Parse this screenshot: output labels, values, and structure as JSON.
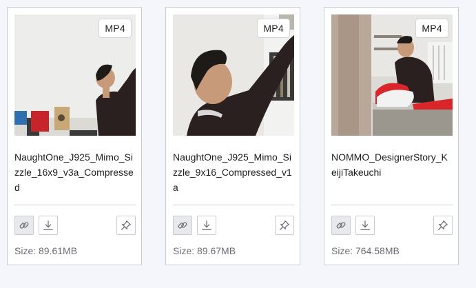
{
  "assets": [
    {
      "format": "MP4",
      "filename": "NaughtOne_J925_Mimo_Sizzle_16x9_v3a_Compressed",
      "size": "Size: 89.61MB"
    },
    {
      "format": "MP4",
      "filename": "NaughtOne_J925_Mimo_Sizzle_9x16_Compressed_v1a",
      "size": "Size: 89.67MB"
    },
    {
      "format": "MP4",
      "filename": "NOMMO_DesignerStory_KeijiTakeuchi",
      "size": "Size: 764.58MB"
    }
  ],
  "icons": {
    "copy_link": "link-icon",
    "download": "download-icon",
    "pin": "pin-icon"
  },
  "colors": {
    "card_border": "#c9ccd2",
    "accent_red": "#d9262b"
  }
}
